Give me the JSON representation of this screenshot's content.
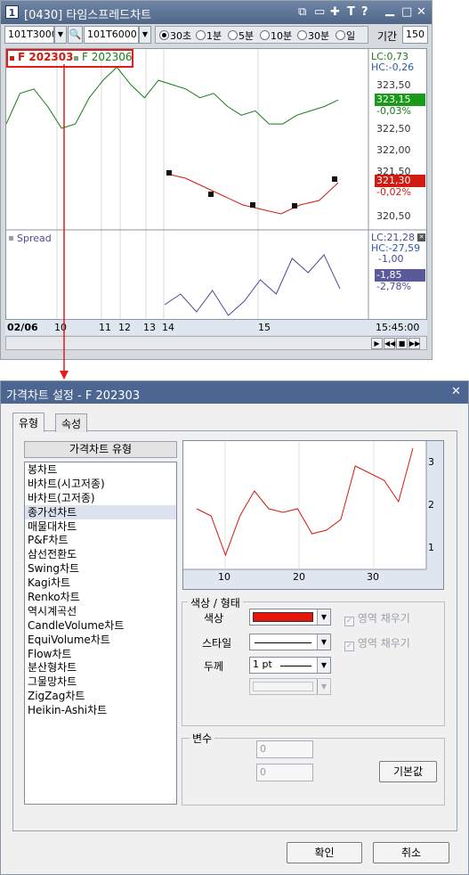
{
  "window": {
    "icon": "1",
    "title": "[0430] 타임스프레드차트",
    "title_buttons": [
      "⧉",
      "▭",
      "✚",
      "T",
      "?",
      "▁",
      "□",
      "✕"
    ]
  },
  "toolbar": {
    "code1": "101T3000",
    "code2": "101T6000",
    "intervals": [
      "30초",
      "1분",
      "5분",
      "10분",
      "30분",
      "일"
    ],
    "selected_interval": "30초",
    "period_label": "기간",
    "period_value": "150"
  },
  "price_pane": {
    "legend_main": "F 202303",
    "legend_second": "F 202306",
    "lc": "LC:0,73",
    "hc": "HC:-0,26",
    "y_ticks": [
      "323,50",
      "323,00",
      "322,50",
      "322,00",
      "321,50",
      "321,00",
      "320,50"
    ],
    "badge_green_value": "323,15",
    "badge_green_pct": "-0,03%",
    "badge_red_value": "321,30",
    "badge_red_pct": "-0,02%",
    "colors": {
      "green": "#1a7a1a",
      "red": "#d11a10"
    }
  },
  "spread_pane": {
    "label": "Spread",
    "lc": "LC:21,28",
    "hc": "HC:-27,59",
    "tick_top": "-1,00",
    "badge_value": "-1,85",
    "badge_pct": "-2,78%",
    "color": "#4a4a9a"
  },
  "time_axis": {
    "date": "02/06",
    "labels": [
      "10",
      "11",
      "12",
      "13",
      "14",
      "15"
    ],
    "time": "15:45:00"
  },
  "dialog": {
    "title": "가격차트 설정 - F 202303",
    "close": "✕",
    "tabs": [
      "유형",
      "속성"
    ],
    "list_header": "가격차트 유형",
    "list_items": [
      "봉차트",
      "바차트(시고저종)",
      "바차트(고저종)",
      "종가선차트",
      "매물대차트",
      "P&F차트",
      "삼선전환도",
      "Swing차트",
      "Kagi차트",
      "Renko차트",
      "역시계곡선",
      "CandleVolume차트",
      "EquiVolume차트",
      "Flow차트",
      "분산형차트",
      "그물망차트",
      "ZigZag차트",
      "Heikin-Ashi차트"
    ],
    "selected_item": "종가선차트",
    "preview": {
      "y_ticks": [
        "3",
        "2",
        "1"
      ],
      "x_ticks": [
        "10",
        "20",
        "30"
      ]
    },
    "color_group": {
      "title": "색상 / 형태",
      "color_label": "색상",
      "style_label": "스타일",
      "width_label": "두께",
      "width_value": "1 pt",
      "fill_label_1": "영역 채우기",
      "fill_label_2": "영역 채우기",
      "swatch_color": "#e8140c"
    },
    "var_group": {
      "title": "변수",
      "value1": "0",
      "value2": "0",
      "default_button": "기본값"
    },
    "ok": "확인",
    "cancel": "취소"
  },
  "chart_data": {
    "type": "line",
    "series": [
      {
        "name": "F 202306",
        "color": "#1a7a1a",
        "values": [
          322.6,
          323.3,
          323.4,
          323.0,
          322.5,
          322.6,
          323.2,
          323.6,
          323.9,
          323.5,
          323.2,
          323.6,
          323.5,
          323.4,
          323.2,
          323.3,
          323.0,
          322.8,
          322.9,
          322.6,
          322.6,
          322.8,
          322.9,
          323.0,
          323.15
        ]
      },
      {
        "name": "F 202303",
        "values": [
          321.5,
          321.4,
          321.2,
          321.0,
          320.8,
          320.7,
          320.6,
          320.8,
          320.9,
          321.3
        ]
      },
      {
        "name": "Spread",
        "values": [
          -2.3,
          -2.0,
          -2.5,
          -1.9,
          -2.6,
          -2.2,
          -1.6,
          -2.0,
          -1.0,
          -1.4,
          -0.9,
          -1.85
        ]
      }
    ],
    "preview_values": [
      1.6,
      1.4,
      0.3,
      1.4,
      2.1,
      1.6,
      1.5,
      1.6,
      0.9,
      1.0,
      1.3,
      2.8,
      2.6,
      2.4,
      1.8,
      3.3
    ]
  }
}
